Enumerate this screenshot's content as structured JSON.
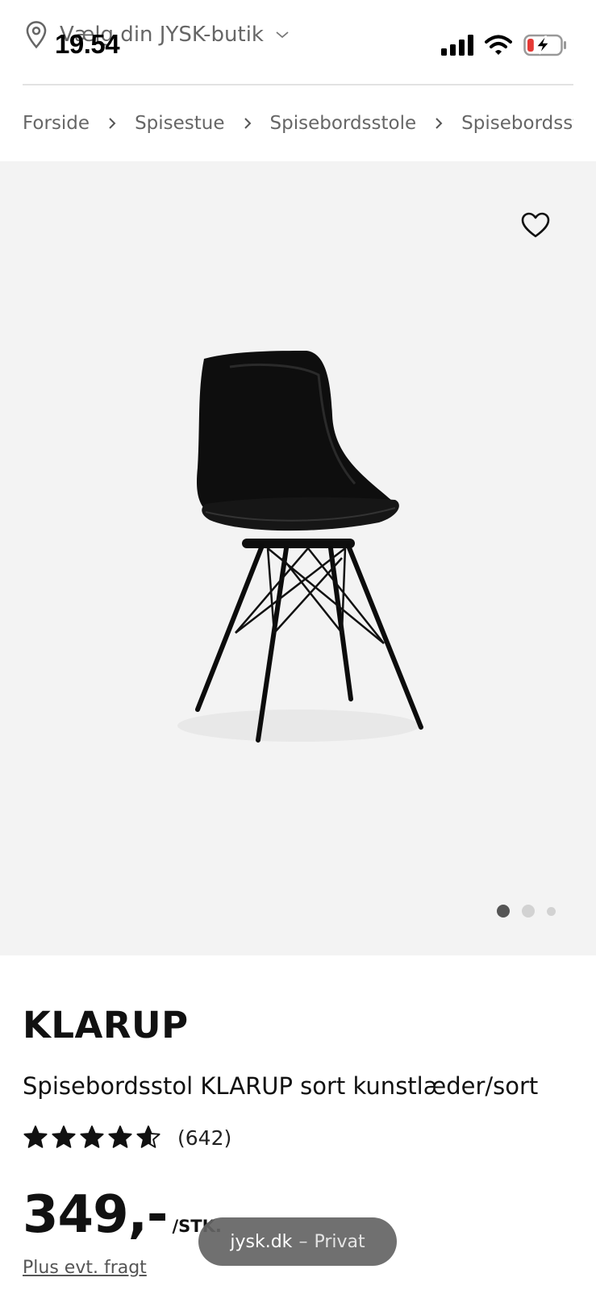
{
  "status_bar": {
    "time": "19.54",
    "battery_level": 0.2,
    "icons": [
      "cellular-signal-icon",
      "wifi-icon",
      "battery-charging-icon"
    ]
  },
  "header": {
    "store_selector_label": "Vælg din JYSK-butik",
    "icons": [
      "location-pin-icon",
      "chevron-down-icon"
    ]
  },
  "breadcrumb": {
    "items": [
      "Forside",
      "Spisestue",
      "Spisebordsstole",
      "Spisebordsstol KLARUP"
    ]
  },
  "gallery": {
    "image_count": 3,
    "active_index": 0,
    "favorite_icon": "heart-outline-icon",
    "background": "#f3f3f3"
  },
  "product": {
    "brand": "KLARUP",
    "name": "Spisebordsstol KLARUP sort kunstlæder/sort",
    "rating": 4.6,
    "rating_count": "(642)",
    "price": "349,-",
    "price_unit": "/STK.",
    "shipping_note": "Plus evt. fragt"
  },
  "browser": {
    "domain": "jysk.dk",
    "separator": "–",
    "mode": "Privat"
  },
  "colors": {
    "text_primary": "#111111",
    "text_secondary": "#666666",
    "battery_low": "#e53935",
    "pill_background": "#646464"
  }
}
